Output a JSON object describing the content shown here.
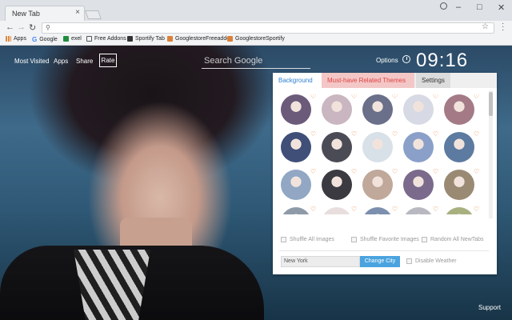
{
  "browser": {
    "tab_title": "New Tab",
    "tab_close": "×",
    "window_controls": [
      "–",
      "□",
      "✕"
    ],
    "omnibox_icon": "search-icon",
    "bookmark_star": "☆",
    "bookmarks": [
      {
        "label": "Apps",
        "icon": "apps-grid-icon",
        "color": "#e0863a"
      },
      {
        "label": "Google",
        "icon": "google-g-icon",
        "color": "#4285f4"
      },
      {
        "label": "exel",
        "icon": "spreadsheet-icon",
        "color": "#1e8e3e"
      },
      {
        "label": "Free Addons",
        "icon": "page-icon",
        "color": "#555555"
      },
      {
        "label": "Sportify Tab",
        "icon": "page-icon",
        "color": "#333333"
      },
      {
        "label": "GooglestoreFreeaddo",
        "icon": "store-icon",
        "color": "#d9813a"
      },
      {
        "label": "GooglestoreSportify",
        "icon": "store-icon",
        "color": "#d9813a"
      }
    ]
  },
  "ntp": {
    "links": {
      "most_visited": "Most Visited",
      "apps": "Apps",
      "share": "Share",
      "rate": "Rate"
    },
    "search_placeholder": "Search Google",
    "options_label": "Options",
    "clock_icon": "clock-icon",
    "time": "09:16",
    "support_label": "Support"
  },
  "panel": {
    "tabs": {
      "background": "Background",
      "themes": "Must-have Related Themes",
      "settings": "Settings"
    },
    "thumbnails": [
      "#6b5a7a",
      "#c9b6c0",
      "#6a6f8a",
      "#d7d9e4",
      "#a37a86",
      "#3f4f78",
      "#4b4b55",
      "#d8e0e8",
      "#8aa0c8",
      "#5d7aa0",
      "#91a7c4",
      "#3a3a40",
      "#c0a89a",
      "#7b6a8c",
      "#9a8a74",
      "#8e9aa8",
      "#e9dede",
      "#7c8fae",
      "#b8b8c0",
      "#a8b080"
    ],
    "heart_symbol": "♡",
    "options": {
      "shuffle_all": "Shuffle All Images",
      "shuffle_fav": "Shuffle Favorite Images",
      "random_all": "Random All NewTabs"
    },
    "city_value": "New York",
    "change_city": "Change City",
    "disable_weather": "Disable Weather"
  }
}
